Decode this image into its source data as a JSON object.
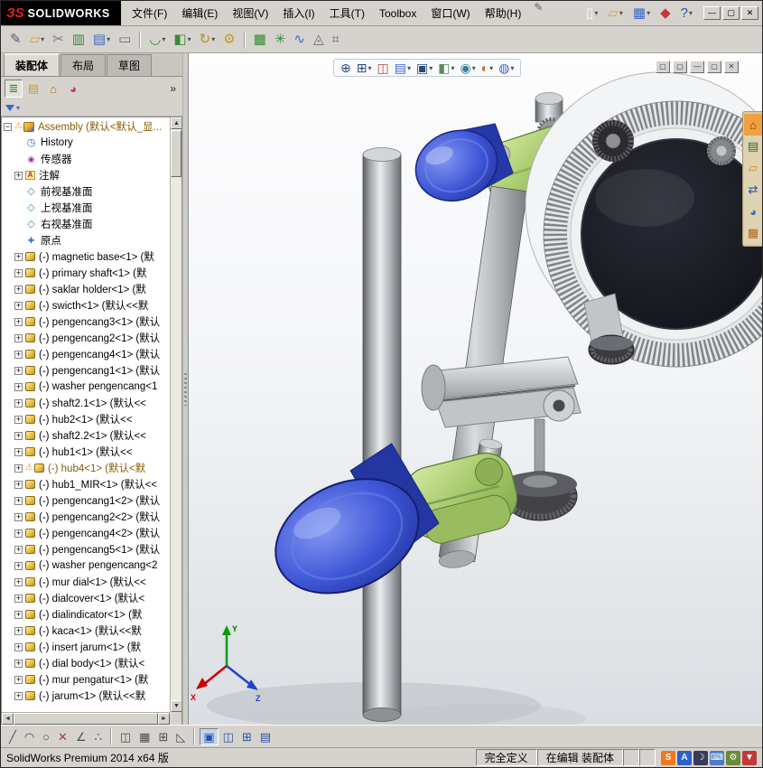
{
  "titlebar": {
    "brand_mark": "ЗS",
    "brand": "SOLIDWORKS",
    "menus": [
      "文件(F)",
      "编辑(E)",
      "视图(V)",
      "插入(I)",
      "工具(T)",
      "Toolbox",
      "窗口(W)",
      "帮助(H)"
    ],
    "quick_icons": [
      {
        "name": "new-document-icon",
        "glyph": "▯",
        "color": "#f8f8f8",
        "dropdown": true
      },
      {
        "name": "open-icon",
        "glyph": "▱",
        "color": "#e0a82a",
        "dropdown": true
      },
      {
        "name": "save-icon",
        "glyph": "▦",
        "color": "#3a66c8",
        "dropdown": true
      },
      {
        "name": "rebuild-icon",
        "glyph": "◆",
        "color": "#c03a3a",
        "dropdown": false
      },
      {
        "name": "help-icon",
        "glyph": "?",
        "color": "#2a52a8",
        "dropdown": true
      }
    ],
    "window_buttons": [
      {
        "name": "minimize-button",
        "glyph": "—"
      },
      {
        "name": "maximize-button",
        "glyph": "▢"
      },
      {
        "name": "close-button",
        "glyph": "✕"
      }
    ]
  },
  "toolbar": {
    "icons": [
      {
        "name": "pin-toolbar-icon",
        "glyph": "✎",
        "color": "#5a5d60"
      },
      {
        "name": "open-recent-icon",
        "glyph": "▱",
        "color": "#d8a020",
        "dropdown": true
      },
      {
        "name": "attachment-icon",
        "glyph": "✂",
        "color": "#7a7d80"
      },
      {
        "name": "design-table-icon",
        "glyph": "▥",
        "color": "#3a8a3a"
      },
      {
        "name": "measure-icon",
        "glyph": "▤",
        "color": "#3a66c8",
        "dropdown": true
      },
      {
        "name": "print-preview-icon",
        "glyph": "▭",
        "color": "#6a6d70"
      },
      {
        "sep": true
      },
      {
        "name": "mate-icon",
        "glyph": "◡",
        "color": "#3a8a3a",
        "dropdown": true
      },
      {
        "name": "insert-component-icon",
        "glyph": "◧",
        "color": "#3a8a3a",
        "dropdown": true
      },
      {
        "name": "rotate-component-icon",
        "glyph": "↻",
        "color": "#c08a20",
        "dropdown": true
      },
      {
        "name": "assembly-features-icon",
        "glyph": "⚙",
        "color": "#c0a020"
      },
      {
        "sep": true
      },
      {
        "name": "bom-table-icon",
        "glyph": "▦",
        "color": "#2e8a2e"
      },
      {
        "name": "exploded-view-icon",
        "glyph": "✳",
        "color": "#3a8a3a"
      },
      {
        "name": "spline-curve-icon",
        "glyph": "∿",
        "color": "#3a66c8"
      },
      {
        "name": "interference-check-icon",
        "glyph": "◬",
        "color": "#6a6d70"
      },
      {
        "name": "evaluate-icon",
        "glyph": "⌗",
        "color": "#3a66c8"
      }
    ]
  },
  "commandmanager": {
    "tabs": [
      {
        "label": "装配体",
        "active": true
      },
      {
        "label": "布局"
      },
      {
        "label": "草图"
      }
    ]
  },
  "panel": {
    "tabs": [
      {
        "name": "featuremanager-tree-icon",
        "glyph": "≣",
        "color": "#2e8a2e",
        "active": true
      },
      {
        "name": "propertymanager-icon",
        "glyph": "▤",
        "color": "#c8a028"
      },
      {
        "name": "configurationmanager-icon",
        "glyph": "⌂",
        "color": "#b06820"
      },
      {
        "name": "displaymanager-icon",
        "glyph": "◕",
        "color": "#c03a6a"
      }
    ]
  },
  "tree": {
    "root_label": "Assembly (默认<默认_显...",
    "items": [
      {
        "kind": "history",
        "label": "History"
      },
      {
        "kind": "sensor",
        "label": "传感器"
      },
      {
        "kind": "annotation",
        "label": "注解",
        "expandable": true
      },
      {
        "kind": "plane",
        "label": "前视基准面"
      },
      {
        "kind": "plane",
        "label": "上视基准面"
      },
      {
        "kind": "plane",
        "label": "右视基准面"
      },
      {
        "kind": "origin",
        "label": "原点"
      },
      {
        "kind": "component",
        "expandable": true,
        "label": "(-) magnetic base<1> (默"
      },
      {
        "kind": "component",
        "expandable": true,
        "label": "(-) primary shaft<1> (默"
      },
      {
        "kind": "component",
        "expandable": true,
        "label": "(-) saklar holder<1> (默"
      },
      {
        "kind": "component",
        "expandable": true,
        "label": "(-) swicth<1> (默认<<默"
      },
      {
        "kind": "component",
        "expandable": true,
        "label": "(-) pengencang3<1> (默认"
      },
      {
        "kind": "component",
        "expandable": true,
        "label": "(-) pengencang2<1> (默认"
      },
      {
        "kind": "component",
        "expandable": true,
        "label": "(-) pengencang4<1> (默认"
      },
      {
        "kind": "component",
        "expandable": true,
        "label": "(-) pengencang1<1> (默认"
      },
      {
        "kind": "component",
        "expandable": true,
        "label": "(-) washer pengencang<1"
      },
      {
        "kind": "component",
        "expandable": true,
        "label": "(-) shaft2.1<1> (默认<<"
      },
      {
        "kind": "component",
        "expandable": true,
        "label": "(-) hub2<1> (默认<<"
      },
      {
        "kind": "component",
        "expandable": true,
        "label": "(-) shaft2.2<1> (默认<<"
      },
      {
        "kind": "component",
        "expandable": true,
        "label": "(-) hub1<1> (默认<<"
      },
      {
        "kind": "component",
        "expandable": true,
        "warning": true,
        "label": "(-) hub4<1> (默认<默"
      },
      {
        "kind": "component",
        "expandable": true,
        "label": "(-) hub1_MIR<1> (默认<<"
      },
      {
        "kind": "component",
        "expandable": true,
        "label": "(-) pengencang1<2> (默认"
      },
      {
        "kind": "component",
        "expandable": true,
        "label": "(-) pengencang2<2> (默认"
      },
      {
        "kind": "component",
        "expandable": true,
        "label": "(-) pengencang4<2> (默认"
      },
      {
        "kind": "component",
        "expandable": true,
        "label": "(-) pengencang5<1> (默认"
      },
      {
        "kind": "component",
        "expandable": true,
        "label": "(-) washer pengencang<2"
      },
      {
        "kind": "component",
        "expandable": true,
        "label": "(-) mur dial<1> (默认<<"
      },
      {
        "kind": "component",
        "expandable": true,
        "label": "(-) dialcover<1> (默认<"
      },
      {
        "kind": "component",
        "expandable": true,
        "label": "(-) dialindicator<1> (默"
      },
      {
        "kind": "component",
        "expandable": true,
        "label": "(-) kaca<1> (默认<<默"
      },
      {
        "kind": "component",
        "expandable": true,
        "label": "(-) insert jarum<1> (默"
      },
      {
        "kind": "component",
        "expandable": true,
        "label": "(-) dial body<1> (默认<"
      },
      {
        "kind": "component",
        "expandable": true,
        "label": "(-) mur pengatur<1> (默"
      },
      {
        "kind": "component",
        "expandable": true,
        "label": "(-) jarum<1> (默认<<默"
      }
    ]
  },
  "viewport": {
    "headsup": [
      {
        "name": "zoom-fit-icon",
        "glyph": "⊕",
        "color": "#2a4a7a"
      },
      {
        "name": "zoom-area-icon",
        "glyph": "⊞",
        "color": "#2a4a7a",
        "dropdown": true
      },
      {
        "name": "section-view-icon",
        "glyph": "◫",
        "color": "#b04a3a"
      },
      {
        "name": "annotation-visibility-icon",
        "glyph": "▤",
        "color": "#3a66c8",
        "dropdown": true
      },
      {
        "name": "view-orientation-icon",
        "glyph": "▣",
        "color": "#2a4a7a",
        "dropdown": true
      },
      {
        "name": "display-style-icon",
        "glyph": "◧",
        "color": "#5a8a5a",
        "dropdown": true
      },
      {
        "name": "hide-show-items-icon",
        "glyph": "◉",
        "color": "#3a7a9a",
        "dropdown": true
      },
      {
        "name": "edit-appearance-icon",
        "glyph": "◐",
        "color": "#c06a2a",
        "dropdown": true
      },
      {
        "name": "view-settings-icon",
        "glyph": "◍",
        "color": "#3a66c8",
        "dropdown": true
      }
    ],
    "mdi_buttons": [
      {
        "name": "doc-window-restore-icon",
        "glyph": "▢"
      },
      {
        "name": "doc-window-cascade-icon",
        "glyph": "▢"
      },
      {
        "name": "doc-window-minimize-icon",
        "glyph": "—"
      },
      {
        "name": "doc-window-maximize-icon",
        "glyph": "▢"
      },
      {
        "name": "doc-window-close-icon",
        "glyph": "✕"
      }
    ],
    "taskpane": [
      {
        "name": "home-icon",
        "glyph": "⌂",
        "color": "#7a3a08",
        "bg": "#f0a040"
      },
      {
        "name": "design-library-icon",
        "glyph": "▤",
        "color": "#2e6a2e",
        "bg": "#ded2b0"
      },
      {
        "name": "file-explorer-icon",
        "glyph": "▱",
        "color": "#c8901a",
        "bg": "#ded2b0"
      },
      {
        "name": "view-palette-icon",
        "glyph": "⇄",
        "color": "#2a52a8",
        "bg": "#ded2b0"
      },
      {
        "name": "appearances-scenes-icon",
        "glyph": "◕",
        "color": "#2a7ab0",
        "bg": "#ded2b0"
      },
      {
        "name": "custom-properties-icon",
        "glyph": "▦",
        "color": "#b06820",
        "bg": "#ded2b0"
      }
    ]
  },
  "bottom_toolbar": {
    "icons": [
      {
        "name": "sketch-line-icon",
        "glyph": "╱",
        "color": "#4a4d50"
      },
      {
        "name": "sketch-arc-icon",
        "glyph": "◠",
        "color": "#4a4d50"
      },
      {
        "name": "sketch-circle-icon",
        "glyph": "○",
        "color": "#4a4d50"
      },
      {
        "name": "trim-entities-icon",
        "glyph": "✕",
        "color": "#a04040"
      },
      {
        "name": "sketch-angle-icon",
        "glyph": "∠",
        "color": "#4a4d50"
      },
      {
        "name": "sketch-point-icon",
        "glyph": "∴",
        "color": "#4a4d50"
      },
      {
        "sep": true
      },
      {
        "name": "mirror-entities-icon",
        "glyph": "◫",
        "color": "#4a4d50"
      },
      {
        "name": "grid-snap-icon",
        "glyph": "▦",
        "color": "#4a4d50"
      },
      {
        "name": "linear-pattern-icon",
        "glyph": "⊞",
        "color": "#4a4d50"
      },
      {
        "name": "convert-entities-icon",
        "glyph": "◺",
        "color": "#4a4d50"
      },
      {
        "sep": true
      },
      {
        "name": "viewport-single-icon",
        "glyph": "▣",
        "color": "#2a52a8",
        "active": true
      },
      {
        "name": "viewport-two-icon",
        "glyph": "◫",
        "color": "#2a52a8"
      },
      {
        "name": "viewport-four-icon",
        "glyph": "⊞",
        "color": "#2a52a8"
      },
      {
        "name": "task-pane-toggle-icon",
        "glyph": "▤",
        "color": "#2a52a8"
      }
    ]
  },
  "statusbar": {
    "product": "SolidWorks Premium 2014 x64 版",
    "fully_defined": "完全定义",
    "editing": "在编辑 装配体",
    "tray": [
      {
        "name": "sogou-ime-icon",
        "glyph": "S",
        "bg": "#f07820",
        "color": "#ffffff"
      },
      {
        "name": "ime-mode-icon",
        "glyph": "A",
        "bg": "#2a62c8",
        "color": "#ffffff"
      },
      {
        "name": "night-mode-icon",
        "glyph": "☽",
        "bg": "#3a3a5a",
        "color": "#ffffff"
      },
      {
        "name": "keyboard-icon",
        "glyph": "⌨",
        "bg": "#4a7ac8",
        "color": "#ffffff"
      },
      {
        "name": "tray-settings-icon",
        "glyph": "⚙",
        "bg": "#6a8a3a",
        "color": "#ffffff"
      },
      {
        "name": "tray-pin-icon",
        "glyph": "▼",
        "bg": "#c03a3a",
        "color": "#ffffff"
      }
    ]
  },
  "model_colors": {
    "knob_blue": "#3d55d6",
    "clamp_green": "#a5c96a",
    "steel_gray": "#c6c9cc",
    "dial_face": "#17171f"
  }
}
